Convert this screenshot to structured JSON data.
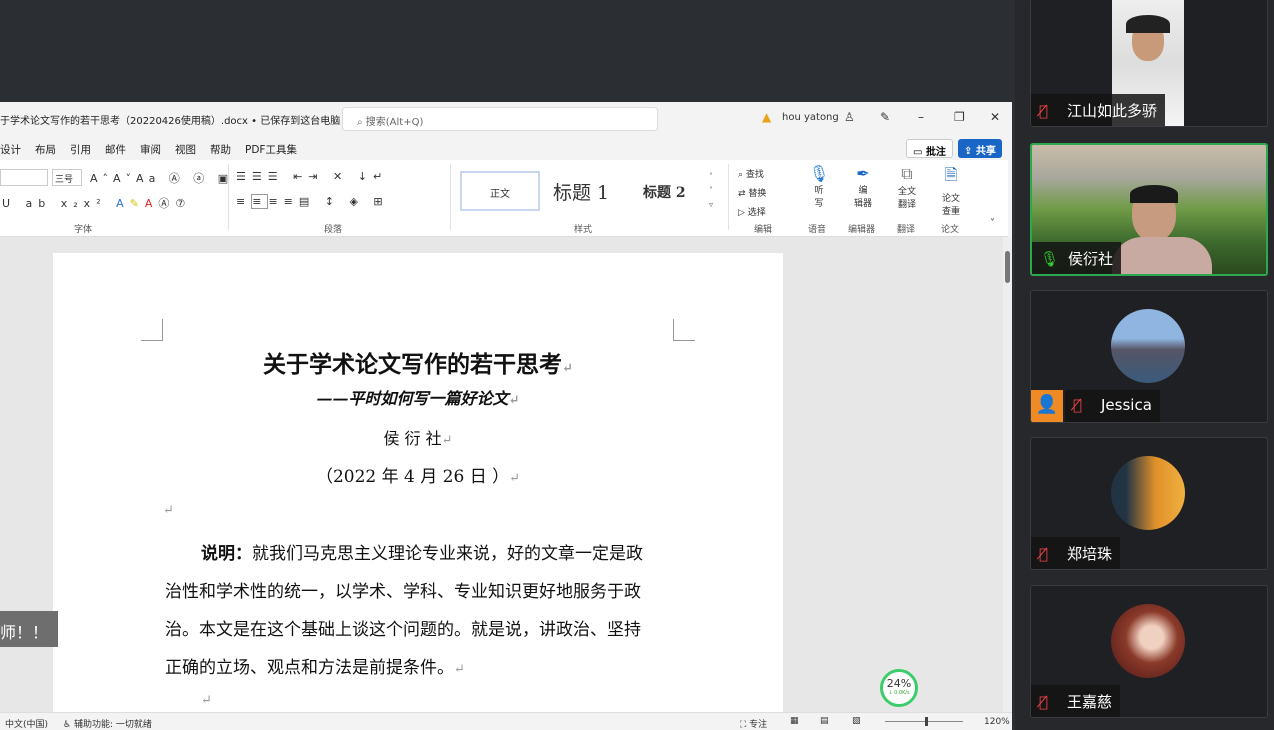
{
  "word": {
    "title": "于学术论文写作的若干思考（20220426使用稿）.docx • 已保存到这台电脑 ▾",
    "search_placeholder": "搜索(Alt+Q)",
    "user": "hou yatong",
    "menu": [
      "设计",
      "布局",
      "引用",
      "邮件",
      "审阅",
      "视图",
      "帮助",
      "PDF工具集"
    ],
    "comment_btn": "批注",
    "share_btn": "共享",
    "font_size": "三号",
    "styles": [
      "正文",
      "标题 1",
      "标题 2"
    ],
    "editing": [
      "查找",
      "替换",
      "选择"
    ],
    "tools": [
      {
        "l": "听\n写"
      },
      {
        "l": "编\n辑器"
      },
      {
        "l": "全文\n翻译"
      },
      {
        "l": "论文\n查重"
      }
    ],
    "groups": [
      "字体",
      "段落",
      "样式",
      "编辑",
      "语音",
      "编辑器",
      "翻译",
      "论文"
    ],
    "accent": "#1a66c6"
  },
  "doc": {
    "title": "关于学术论文写作的若干思考",
    "subtitle": "——平时如何写一篇好论文",
    "author": "侯 衍 社",
    "date": "（2022 年 4 月 26 日 ）",
    "lead": "说明：",
    "lines": [
      "就我们马克思主义理论专业来说，好的文章一定是政",
      "治性和学术性的统一，以学术、学科、专业知识更好地服务于政",
      "治。本文是在这个基础上谈这个问题的。就是说，讲政治、坚持",
      "正确的立场、观点和方法是前提条件。"
    ]
  },
  "status": {
    "lang": "中文(中国)",
    "access": "辅助功能: 一切就绪",
    "focus": "专注",
    "zoom": "120%"
  },
  "toast": "师！！",
  "cpu": {
    "value": "24%",
    "sub": "↓ 0.0K/s"
  },
  "participants": [
    {
      "name": "江山如此多骄",
      "muted": true
    },
    {
      "name": "侯衍社",
      "muted": false,
      "speaking": true
    },
    {
      "name": "Jessica",
      "muted": true
    },
    {
      "name": "郑培珠",
      "muted": true
    },
    {
      "name": "王嘉慈",
      "muted": true
    }
  ]
}
